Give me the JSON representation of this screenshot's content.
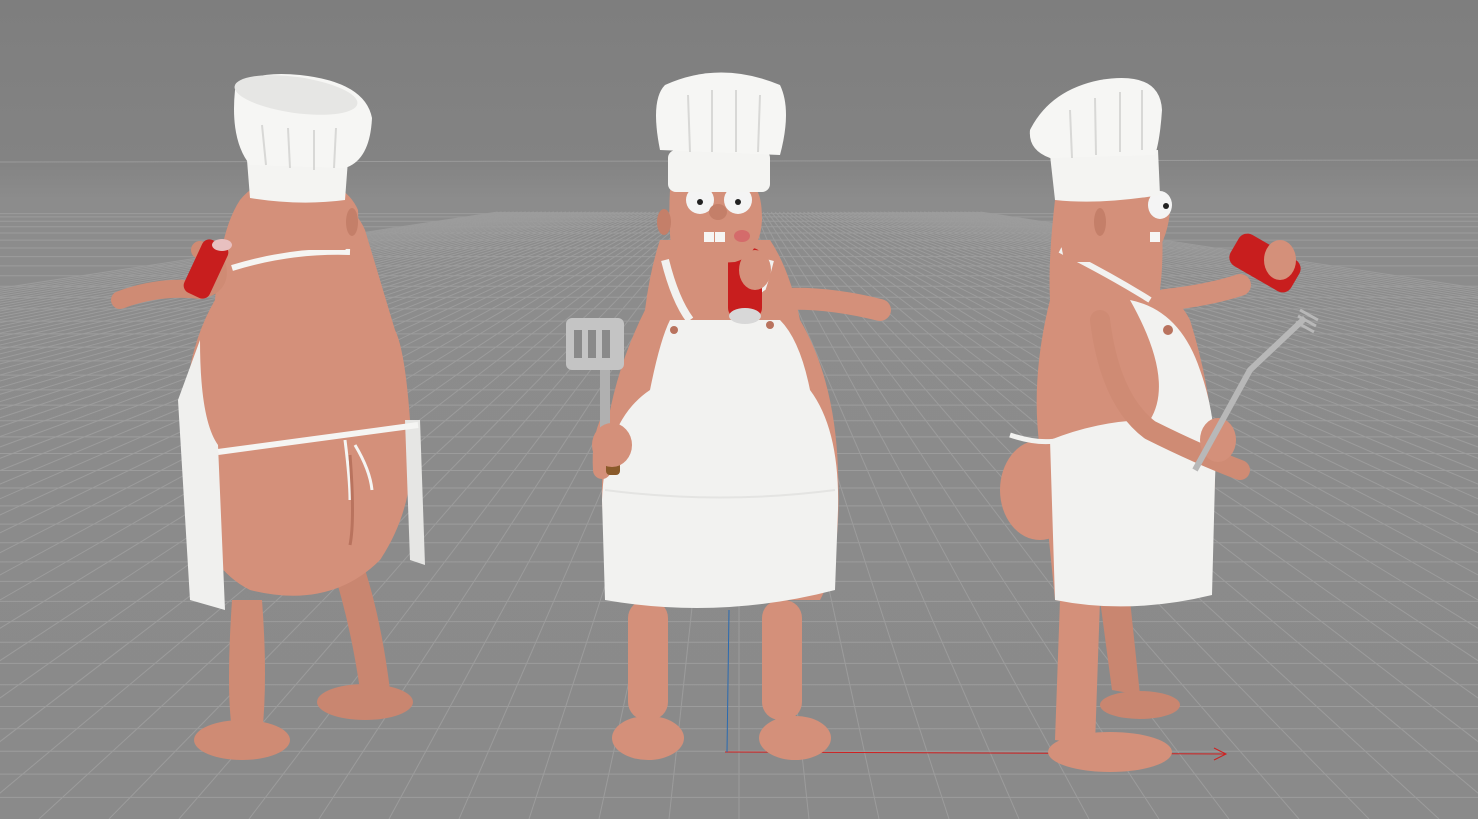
{
  "viewport": {
    "view": "perspective",
    "background_color": "#8a8a8a",
    "grid_color": "#9c9c9c",
    "grid_visible": true
  },
  "axes": {
    "x_axis_color": "#d02020",
    "y_axis_color": "#2a6ab0"
  },
  "colors": {
    "skin": "#d4907a",
    "skin_shadow": "#b9735e",
    "apron": "#f2f2f0",
    "apron_shadow": "#d8d8d6",
    "can_red": "#c81e1e",
    "tool_metal": "#c4c4c4",
    "tool_handle": "#8a5a2a"
  },
  "characters": [
    {
      "view": "back",
      "icon": "chef-character-back-icon"
    },
    {
      "view": "front",
      "icon": "chef-character-front-icon"
    },
    {
      "view": "side",
      "icon": "chef-character-side-icon"
    }
  ]
}
